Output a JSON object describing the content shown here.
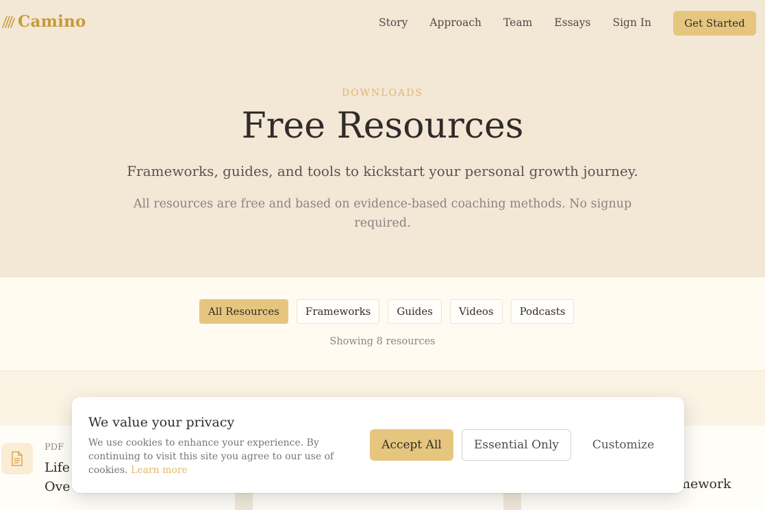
{
  "brand": {
    "name": "Camino",
    "accent": "#e6c67e",
    "logo_color": "#c79a3a"
  },
  "nav": {
    "links": [
      "Story",
      "Approach",
      "Team",
      "Essays",
      "Sign In"
    ],
    "cta": "Get Started"
  },
  "hero": {
    "eyebrow": "DOWNLOADS",
    "title": "Free Resources",
    "subtitle": "Frameworks, guides, and tools to kickstart your personal growth journey.",
    "note": "All resources are free and based on evidence-based coaching methods. No signup required."
  },
  "filters": {
    "chips": [
      "All Resources",
      "Frameworks",
      "Guides",
      "Videos",
      "Podcasts"
    ],
    "active": "All Resources",
    "count_text": "Showing 8 resources"
  },
  "cards": [
    {
      "type": "PDF",
      "title_line1": "Life",
      "title_line2": "Ove",
      "icon": "document-icon"
    },
    {
      "title_fragment": "mework"
    }
  ],
  "cookie": {
    "title": "We value your privacy",
    "text": "We use cookies to enhance your experience. By continuing to visit this site you agree to our use of cookies.",
    "link": "Learn more",
    "accept": "Accept All",
    "essential": "Essential Only",
    "customize": "Customize"
  }
}
